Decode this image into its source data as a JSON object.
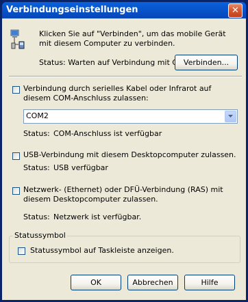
{
  "window": {
    "title": "Verbindungseinstellungen",
    "close_glyph": "✕"
  },
  "intro": {
    "text": "Klicken Sie auf \"Verbinden\", um das mobile Gerät mit diesem Computer zu verbinden.",
    "status": "Status: Warten auf Verbindung mit Gerät",
    "connect_label": "Verbinden..."
  },
  "serial": {
    "checkbox_label": "Verbindung durch serielles Kabel oder Infrarot auf diesem COM-Anschluss zulassen:",
    "checked": false,
    "port_value": "COM2",
    "status_label": "Status:",
    "status_value": "COM-Anschluss ist verfügbar"
  },
  "usb": {
    "checkbox_label": "USB-Verbindung mit diesem Desktopcomputer zulassen.",
    "checked": false,
    "status_label": "Status:",
    "status_value": "USB verfügbar"
  },
  "network": {
    "checkbox_label": "Netzwerk- (Ethernet) oder DFÜ-Verbindung (RAS) mit diesem Desktopcomputer zulassen.",
    "checked": false,
    "status_label": "Status:",
    "status_value": "Netzwerk ist verfügbar."
  },
  "status_symbol": {
    "group_title": "Statussymbol",
    "checkbox_label": "Statussymbol auf Taskleiste anzeigen.",
    "checked": false
  },
  "buttons": {
    "ok": "OK",
    "cancel": "Abbrechen",
    "help": "Hilfe"
  },
  "icons": {
    "device": "connection-computer-device-icon",
    "dropdown": "chevron-down-icon"
  }
}
